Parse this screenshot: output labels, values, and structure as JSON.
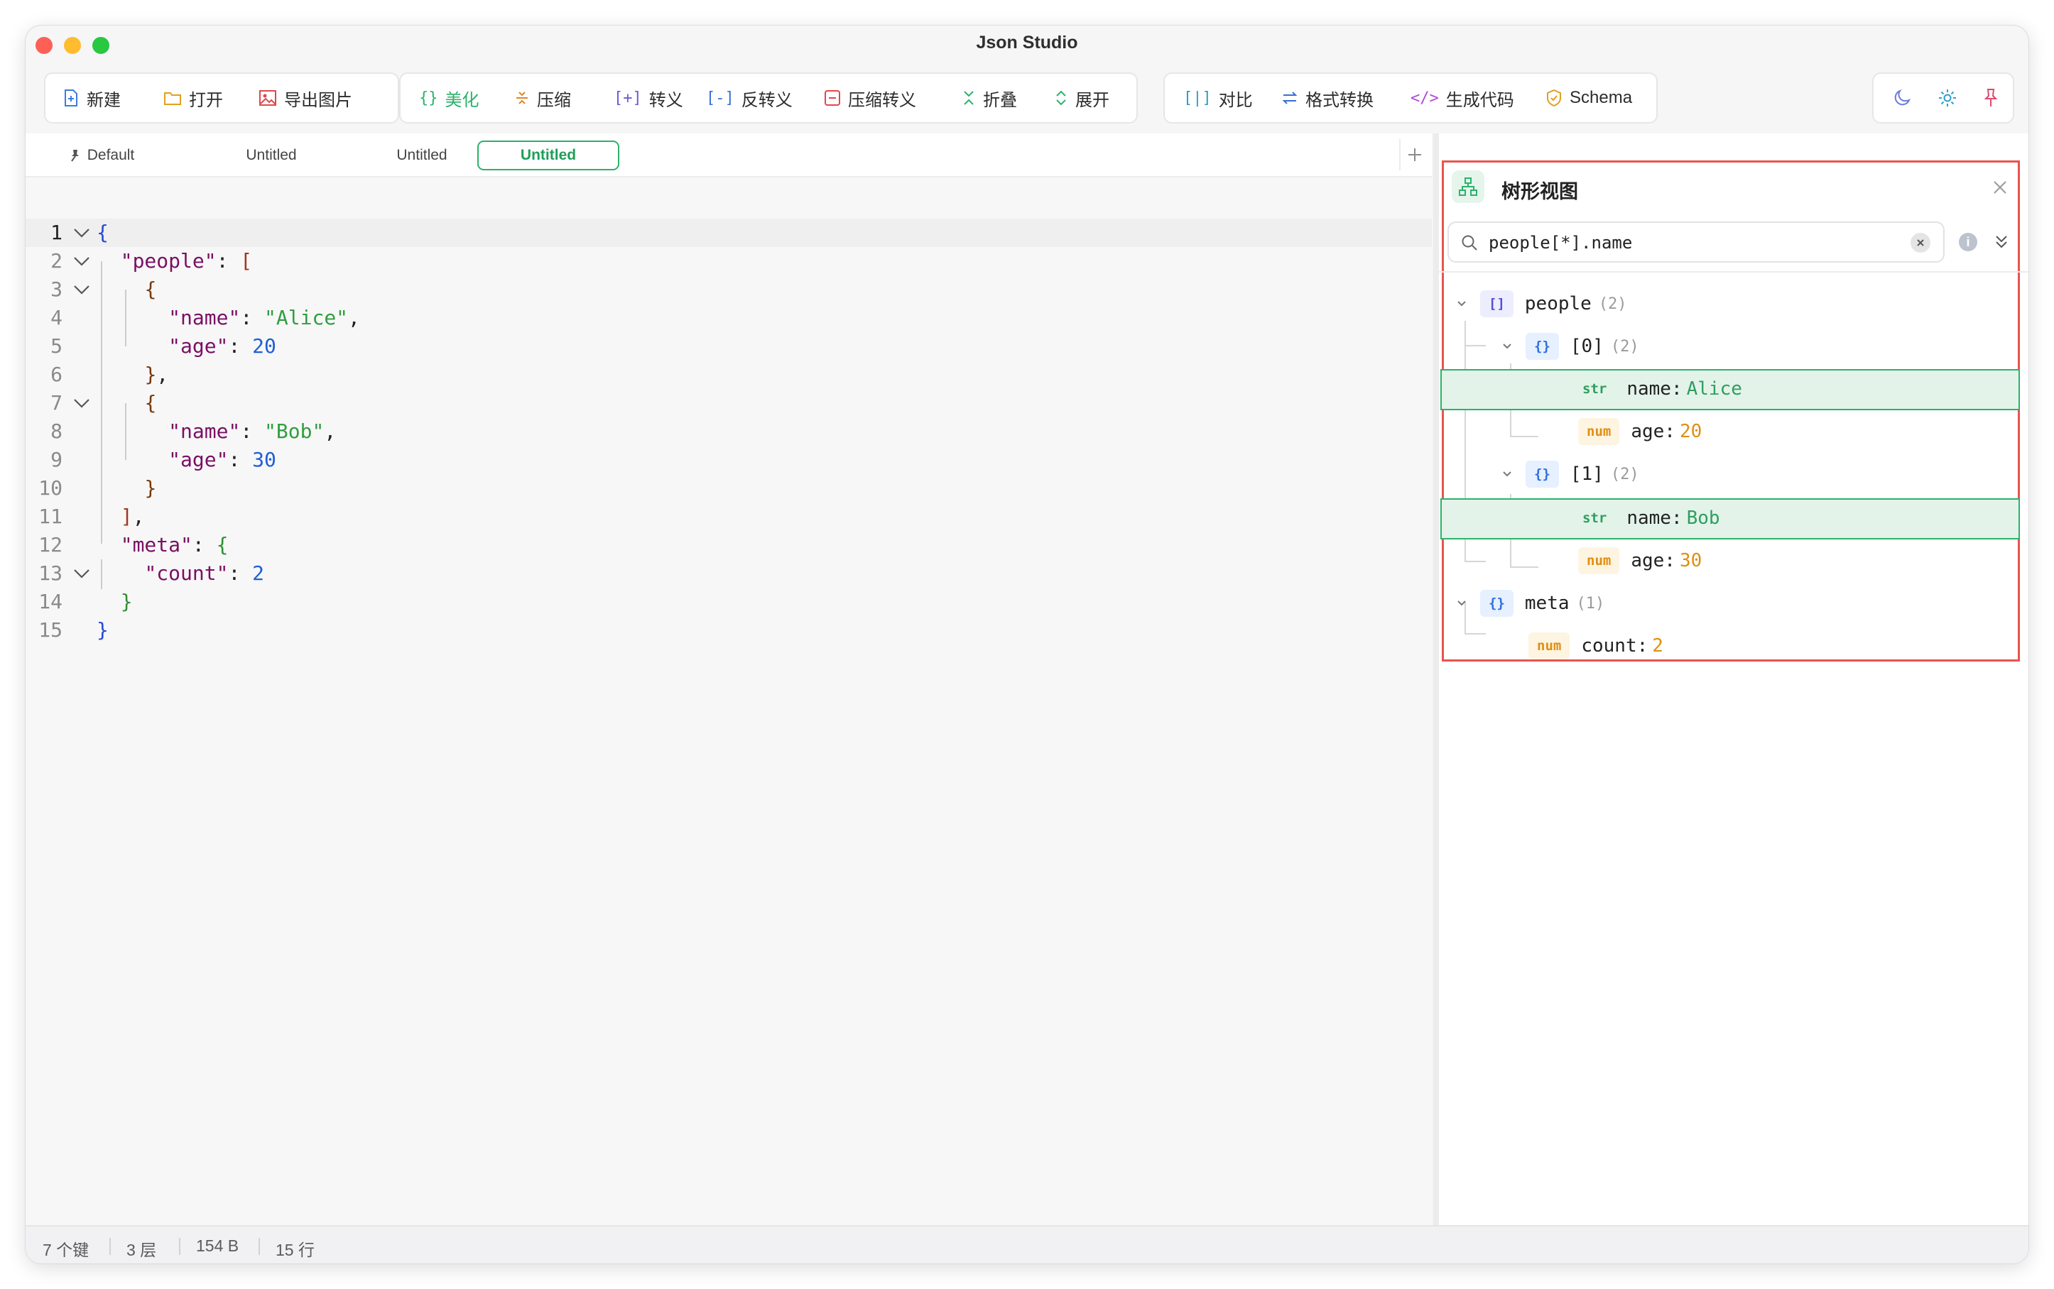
{
  "window": {
    "title": "Json Studio"
  },
  "toolbar": {
    "file": {
      "new": "新建",
      "open": "打开",
      "export_image": "导出图片"
    },
    "format": {
      "beautify": "美化",
      "compress": "压缩",
      "escape": "转义",
      "unescape": "反转义",
      "compress_escape": "压缩转义",
      "collapse": "折叠",
      "expand": "展开"
    },
    "tools": {
      "compare": "对比",
      "convert": "格式转换",
      "codegen": "生成代码",
      "schema": "Schema"
    },
    "colors": {
      "accent": "#2bb26b",
      "export": "#e0474c",
      "theme_icon": "#6b7bd8",
      "settings_icon": "#2aa0c8",
      "pin_icon": "#e0476d"
    }
  },
  "tabs": [
    {
      "label": "Default",
      "pinned": true
    },
    {
      "label": "Untitled"
    },
    {
      "label": "Untitled"
    },
    {
      "label": "Untitled",
      "active": true
    }
  ],
  "editor": {
    "line_numbers": [
      "1",
      "2",
      "3",
      "4",
      "5",
      "6",
      "7",
      "8",
      "9",
      "10",
      "11",
      "12",
      "13",
      "14",
      "15"
    ],
    "current_line": 1
  },
  "tree_panel": {
    "title": "树形视图",
    "search_value": "people[*].name",
    "nodes": {
      "people": {
        "badge": "[]",
        "key": "people",
        "count": "(2)"
      },
      "item0": {
        "badge": "{}",
        "key": "[0]",
        "count": "(2)"
      },
      "item0_name": {
        "badge": "str",
        "key": "name:",
        "value": "Alice"
      },
      "item0_age": {
        "badge": "num",
        "key": "age:",
        "value": "20"
      },
      "item1": {
        "badge": "{}",
        "key": "[1]",
        "count": "(2)"
      },
      "item1_name": {
        "badge": "str",
        "key": "name:",
        "value": "Bob"
      },
      "item1_age": {
        "badge": "num",
        "key": "age:",
        "value": "30"
      },
      "meta": {
        "badge": "{}",
        "key": "meta",
        "count": "(1)"
      },
      "meta_count": {
        "badge": "num",
        "key": "count:",
        "value": "2"
      }
    }
  },
  "status": {
    "keys": "7 个键",
    "depth": "3 层",
    "size": "154 B",
    "lines": "15 行"
  }
}
